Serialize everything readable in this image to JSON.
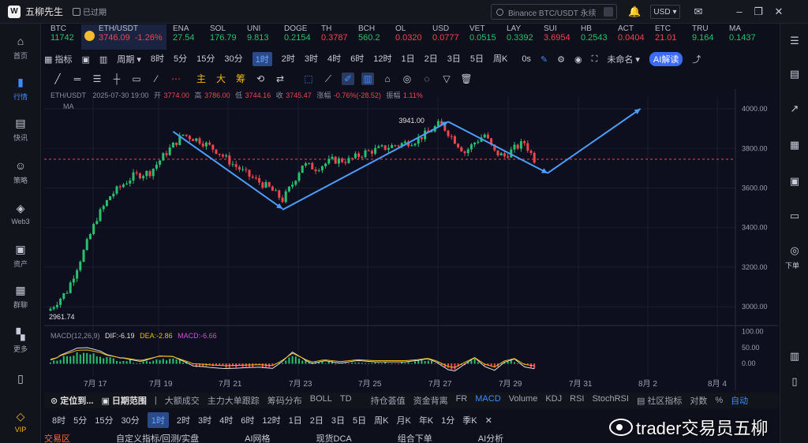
{
  "titlebar": {
    "app_name": "五柳先生",
    "status": "已过期",
    "search_placeholder": "Binance BTC/USDT 永续",
    "currency": "USD"
  },
  "leftnav": [
    {
      "label": "首页",
      "icon": "home-icon"
    },
    {
      "label": "行情",
      "icon": "chart-bars-icon",
      "active": true
    },
    {
      "label": "快讯",
      "icon": "news-icon"
    },
    {
      "label": "策略",
      "icon": "robot-icon"
    },
    {
      "label": "Web3",
      "icon": "web3-icon"
    },
    {
      "label": "资产",
      "icon": "wallet-icon"
    },
    {
      "label": "群聊",
      "icon": "chat-icon"
    },
    {
      "label": "更多",
      "icon": "grid-icon"
    },
    {
      "label": "",
      "icon": "phone-icon"
    },
    {
      "label": "VIP",
      "icon": "vip-diamond-icon"
    }
  ],
  "rightbar": {
    "order_label": "下单"
  },
  "ticker": [
    {
      "sym": "BTC",
      "price": "11742",
      "dir": "up"
    },
    {
      "sym": "ETH/USDT",
      "price": "3746.09",
      "change": "-1.26%",
      "dir": "dn",
      "active": true
    },
    {
      "sym": "ENA",
      "price": "27.54",
      "dir": "up"
    },
    {
      "sym": "SOL",
      "price": "176.79",
      "dir": "up"
    },
    {
      "sym": "UNI",
      "price": "9.813",
      "dir": "up"
    },
    {
      "sym": "DOGE",
      "price": "0.2154",
      "dir": "up"
    },
    {
      "sym": "TH",
      "price": "0.3787",
      "dir": "dn"
    },
    {
      "sym": "BCH",
      "price": "560.2",
      "dir": "up"
    },
    {
      "sym": "OL",
      "price": "0.0320",
      "dir": "dn"
    },
    {
      "sym": "USD",
      "price": "0.0777",
      "dir": "dn"
    },
    {
      "sym": "VET",
      "price": "0.0515",
      "dir": "up"
    },
    {
      "sym": "LAY",
      "price": "0.3392",
      "dir": "up"
    },
    {
      "sym": "SUI",
      "price": "3.6954",
      "dir": "dn"
    },
    {
      "sym": "HB",
      "price": "0.2543",
      "dir": "up"
    },
    {
      "sym": "ACT",
      "price": "0.0404",
      "dir": "dn"
    },
    {
      "sym": "ETC",
      "price": "21.01",
      "dir": "dn"
    },
    {
      "sym": "TRU",
      "price": "9.164",
      "dir": "up"
    },
    {
      "sym": "MA",
      "price": "0.1437",
      "dir": "up"
    }
  ],
  "toolbar1": {
    "indicators": "指标",
    "period_label": "周期",
    "periods": [
      "8时",
      "5分",
      "15分",
      "30分",
      "1时",
      "2时",
      "3时",
      "4时",
      "6时",
      "12时",
      "1日",
      "2日",
      "3日",
      "5日",
      "周K"
    ],
    "selected_period": "1时",
    "countdown": "0s",
    "layout_name": "未命名",
    "ai_label": "AI解读"
  },
  "toolbar2": {
    "gold_labels": [
      "主",
      "大",
      "筹"
    ]
  },
  "chart_data": {
    "type": "candlestick",
    "symbol": "ETH/USDT",
    "info_line": {
      "datetime": "2025-07-30 19:00",
      "open_label": "开",
      "open": "3774.00",
      "high_label": "高",
      "high": "3786.00",
      "low_label": "低",
      "low": "3744.16",
      "close_label": "收",
      "close": "3745.47",
      "change_label": "涨幅",
      "change": "-0.76%(-28.52)",
      "amp_label": "振幅",
      "amp": "1.11%"
    },
    "ma_label": "MA",
    "y_ticks": [
      "4000.00",
      "3800.00",
      "3600.00",
      "3400.00",
      "3200.00",
      "3000.00"
    ],
    "x_ticks": [
      "7月 17",
      "7月 19",
      "7月 21",
      "7月 23",
      "7月 25",
      "7月 27",
      "7月 29",
      "7月 31",
      "8月 2",
      "8月 4"
    ],
    "ylim": [
      2905,
      4060
    ],
    "high_marker": "3941.00",
    "low_marker": "2961.74",
    "close_line": 3745.47,
    "close_path": [
      [
        0,
        2990
      ],
      [
        5,
        3080
      ],
      [
        10,
        3280
      ],
      [
        14,
        3450
      ],
      [
        18,
        3560
      ],
      [
        22,
        3620
      ],
      [
        25,
        3660
      ],
      [
        30,
        3680
      ],
      [
        35,
        3780
      ],
      [
        40,
        3870
      ],
      [
        45,
        3840
      ],
      [
        50,
        3790
      ],
      [
        55,
        3720
      ],
      [
        60,
        3660
      ],
      [
        66,
        3600
      ],
      [
        70,
        3540
      ],
      [
        73,
        3620
      ],
      [
        76,
        3720
      ],
      [
        80,
        3700
      ],
      [
        85,
        3740
      ],
      [
        90,
        3740
      ],
      [
        95,
        3780
      ],
      [
        100,
        3800
      ],
      [
        105,
        3820
      ],
      [
        110,
        3840
      ],
      [
        114,
        3880
      ],
      [
        117,
        3920
      ],
      [
        119,
        3900
      ],
      [
        122,
        3840
      ],
      [
        125,
        3780
      ],
      [
        128,
        3830
      ],
      [
        131,
        3870
      ],
      [
        134,
        3780
      ],
      [
        137,
        3760
      ],
      [
        140,
        3800
      ],
      [
        143,
        3830
      ],
      [
        146,
        3745
      ]
    ],
    "arrows": [
      {
        "from": [
          37,
          3885
        ],
        "to": [
          70,
          3495
        ]
      },
      {
        "from": [
          70,
          3490
        ],
        "to": [
          120,
          3935
        ]
      },
      {
        "from": [
          120,
          3935
        ],
        "to": [
          150,
          3675
        ]
      },
      {
        "from": [
          150,
          3675
        ],
        "to": [
          178,
          4000
        ]
      }
    ],
    "macd": {
      "label": "MACD(12,26,9)",
      "dif": "DIF:-6.19",
      "dea": "DEA:-2.86",
      "macd": "MACD:-6.66",
      "y_ticks": [
        "100.00",
        "50.00",
        "0.00"
      ]
    }
  },
  "bottombar": {
    "locate": "定位到...",
    "date_range": "日期范围",
    "items": [
      "大额成交",
      "主力大单跟踪",
      "筹码分布",
      "BOLL",
      "TD",
      "持仓荟值",
      "资金背离",
      "FR",
      "MACD",
      "Volume",
      "KDJ",
      "RSI",
      "StochRSI"
    ],
    "selected": "MACD",
    "community": "社区指标",
    "log": "对数",
    "pct": "%",
    "auto": "自动"
  },
  "intervals": [
    "8时",
    "5分",
    "15分",
    "30分",
    "1时",
    "2时",
    "3时",
    "4时",
    "6时",
    "12时",
    "1日",
    "2日",
    "3日",
    "5日",
    "周K",
    "月K",
    "年K",
    "1分",
    "季K"
  ],
  "intervals_selected": "1时",
  "tabs": [
    "交易区",
    "自定义指标/回测/实盘",
    "AI网格",
    "现货DCA",
    "组合下单",
    "AI分析"
  ],
  "watermark": "trader交易员五柳"
}
